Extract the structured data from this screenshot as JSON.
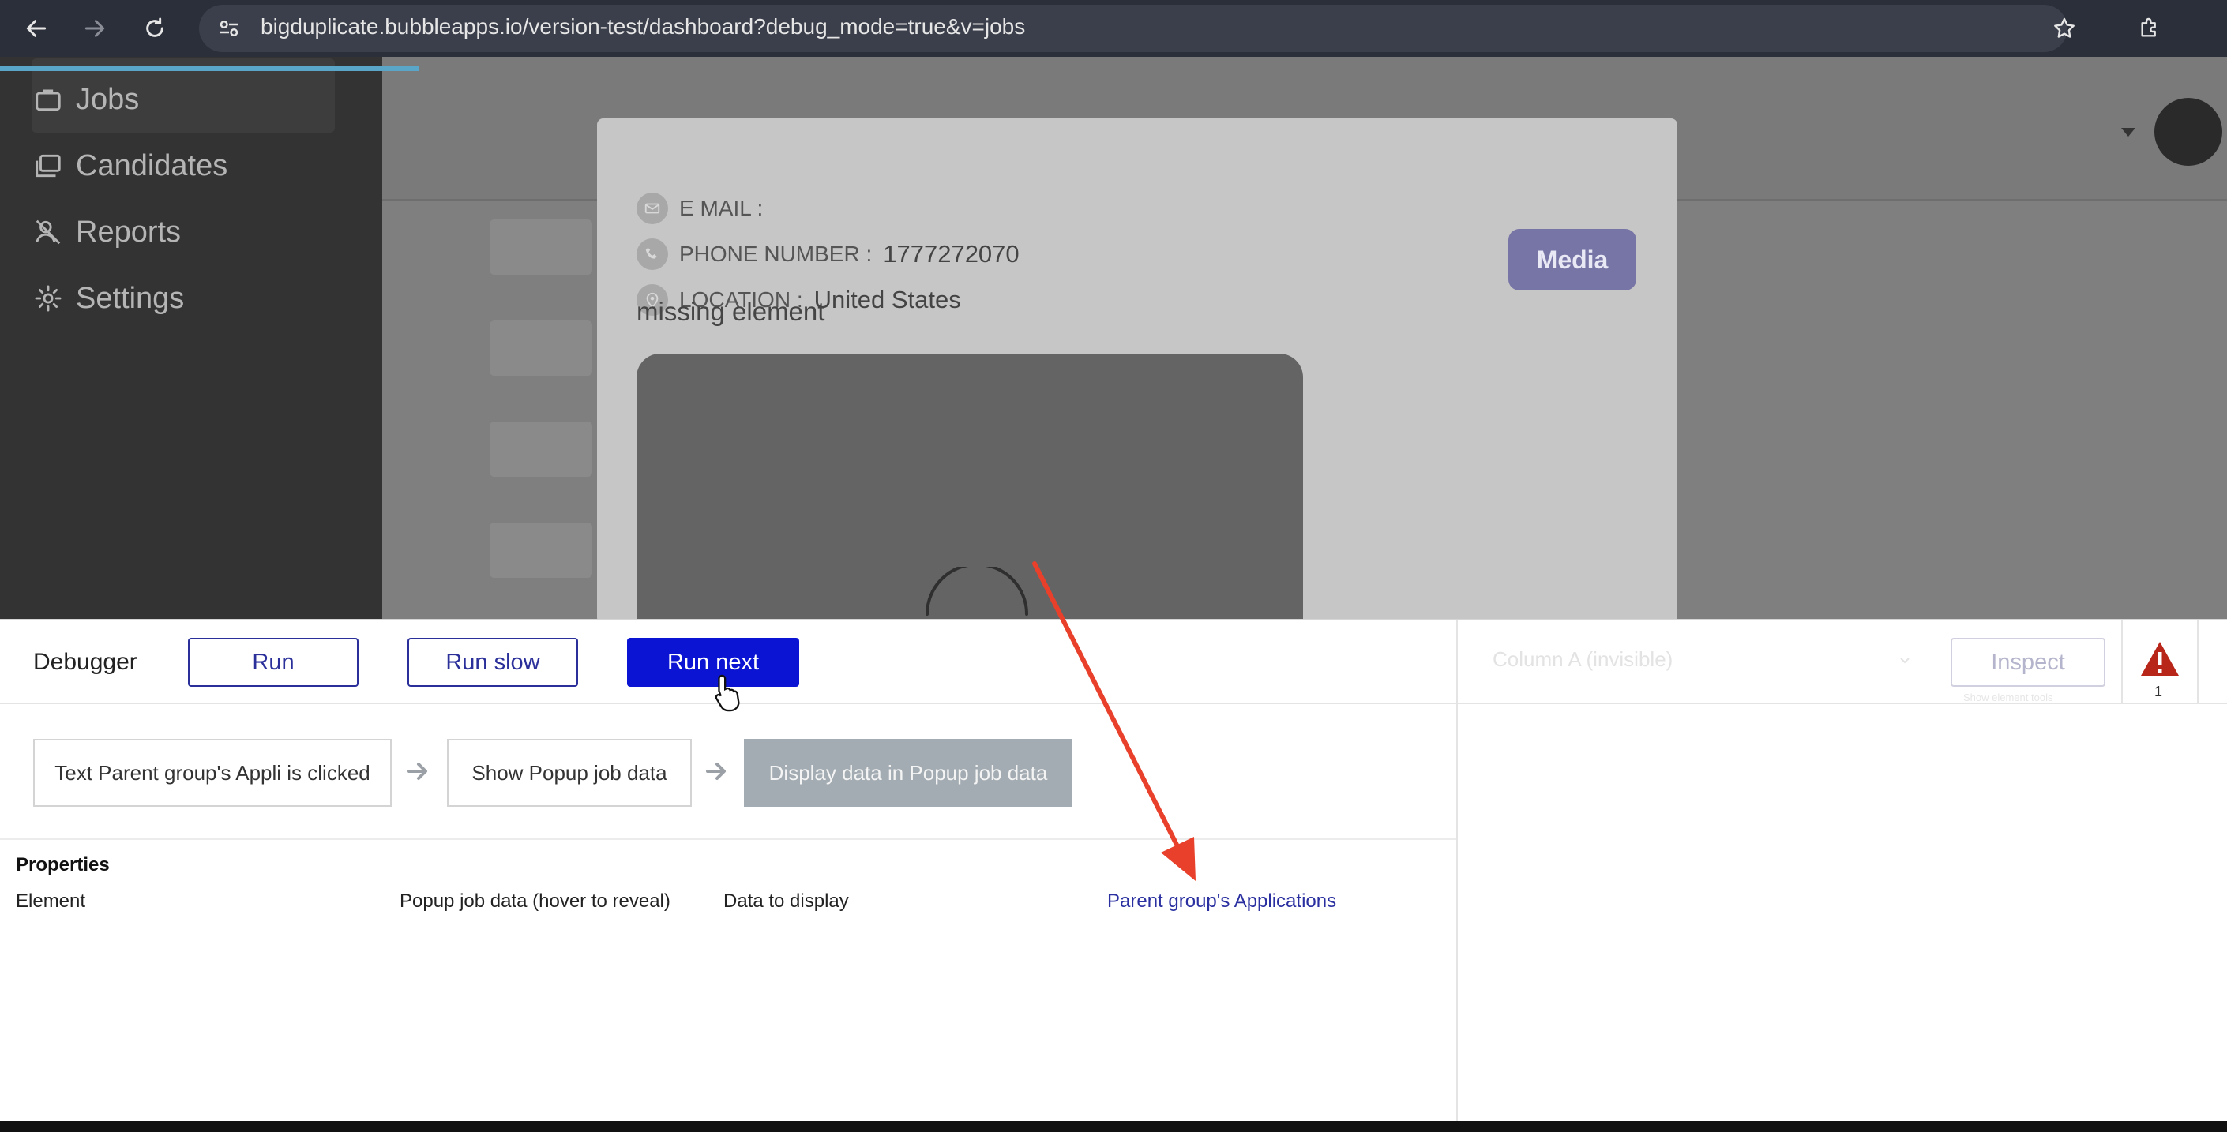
{
  "browser": {
    "url": "bigduplicate.bubbleapps.io/version-test/dashboard?debug_mode=true&v=jobs",
    "icons": [
      "back-arrow-icon",
      "forward-arrow-icon",
      "reload-icon",
      "site-settings-icon",
      "bookmark-star-icon",
      "extensions-icon"
    ]
  },
  "sidebar": {
    "items": [
      {
        "label": "Jobs",
        "icon": "briefcase-icon"
      },
      {
        "label": "Candidates",
        "icon": "folders-icon"
      },
      {
        "label": "Reports",
        "icon": "reports-icon"
      },
      {
        "label": "Settings",
        "icon": "gear-icon"
      }
    ]
  },
  "popup": {
    "fields": [
      {
        "label": "E MAIL :",
        "value": "",
        "icon": "mail-icon"
      },
      {
        "label": "PHONE NUMBER :",
        "value": "1777272070",
        "icon": "phone-icon"
      },
      {
        "label": "LOCATION :",
        "value": "United States",
        "icon": "location-pin-icon"
      }
    ],
    "media_button": "Media",
    "missing_text": "missing element"
  },
  "debugger": {
    "title": "Debugger",
    "buttons": {
      "run": "Run",
      "run_slow": "Run slow",
      "run_next": "Run next"
    },
    "column_select": "Column A (invisible)",
    "inspect": "Inspect",
    "inspect_hint": "Show element tools",
    "warning_count": "1",
    "steps": [
      "Text Parent group's Appli is clicked",
      "Show Popup job data",
      "Display data in Popup job data"
    ],
    "properties": {
      "title": "Properties",
      "element_label": "Element",
      "element_value": "Popup job data (hover to reveal)",
      "data_label": "Data to display",
      "data_value": "Parent group's Applications"
    }
  },
  "colors": {
    "accent_button": "#0a14d2",
    "annotation_arrow": "#e8402a",
    "link": "#2b30a0"
  }
}
